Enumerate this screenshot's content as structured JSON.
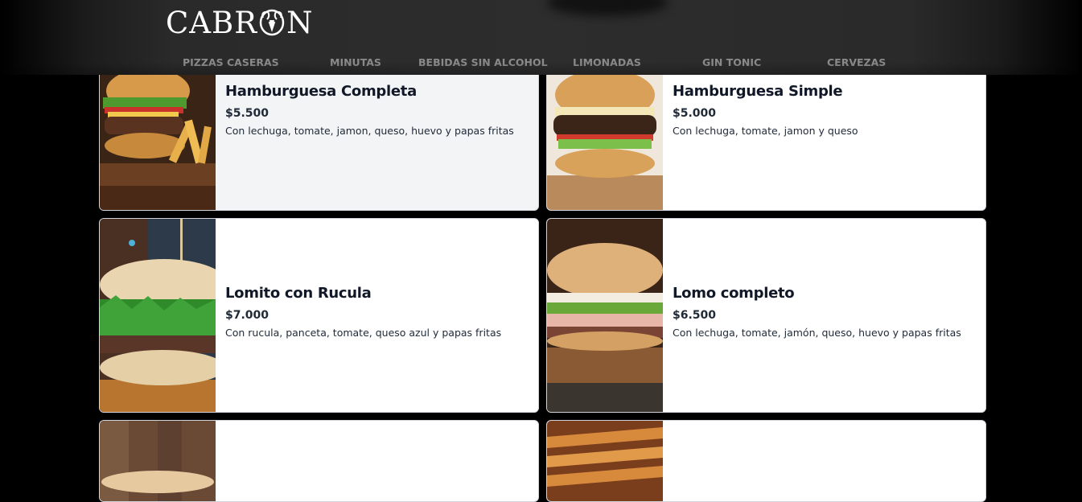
{
  "header": {
    "logo_prefix": "CABR",
    "logo_suffix": "N"
  },
  "nav": [
    {
      "label": "PIZZAS CASERAS"
    },
    {
      "label": "MINUTAS"
    },
    {
      "label": "BEBIDAS SIN ALCOHOL"
    },
    {
      "label": "LIMONADAS"
    },
    {
      "label": "GIN TONIC"
    },
    {
      "label": "CERVEZAS"
    }
  ],
  "items": [
    {
      "title": "Hamburguesa Completa",
      "price": "$5.500",
      "description": "Con lechuga, tomate, jamon, queso, huevo y papas fritas"
    },
    {
      "title": "Hamburguesa Simple",
      "price": "$5.000",
      "description": "Con lechuga, tomate, jamon y queso"
    },
    {
      "title": "Lomito con Rucula",
      "price": "$7.000",
      "description": "Con rucula, panceta, tomate, queso azul y papas fritas"
    },
    {
      "title": "Lomo completo",
      "price": "$6.500",
      "description": "Con lechuga, tomate, jamón, queso, huevo y papas fritas"
    }
  ]
}
